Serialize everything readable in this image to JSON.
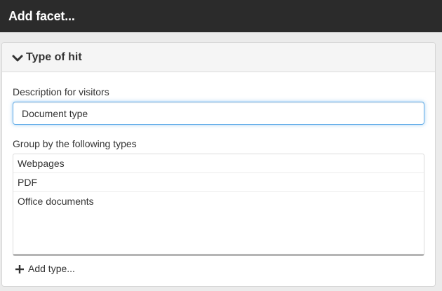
{
  "window": {
    "title": "Add facet..."
  },
  "panel": {
    "heading": "Type of hit",
    "chevron_icon": "chevron-down-icon"
  },
  "description": {
    "label": "Description for visitors",
    "value": "Document type"
  },
  "group": {
    "label": "Group by the following types",
    "items": [
      {
        "label": "Webpages"
      },
      {
        "label": "PDF"
      },
      {
        "label": "Office documents"
      }
    ]
  },
  "add_type": {
    "label": "Add type...",
    "icon": "plus-icon"
  },
  "colors": {
    "titlebar_bg": "#2b2b2b",
    "focus_border": "#66afe9"
  }
}
